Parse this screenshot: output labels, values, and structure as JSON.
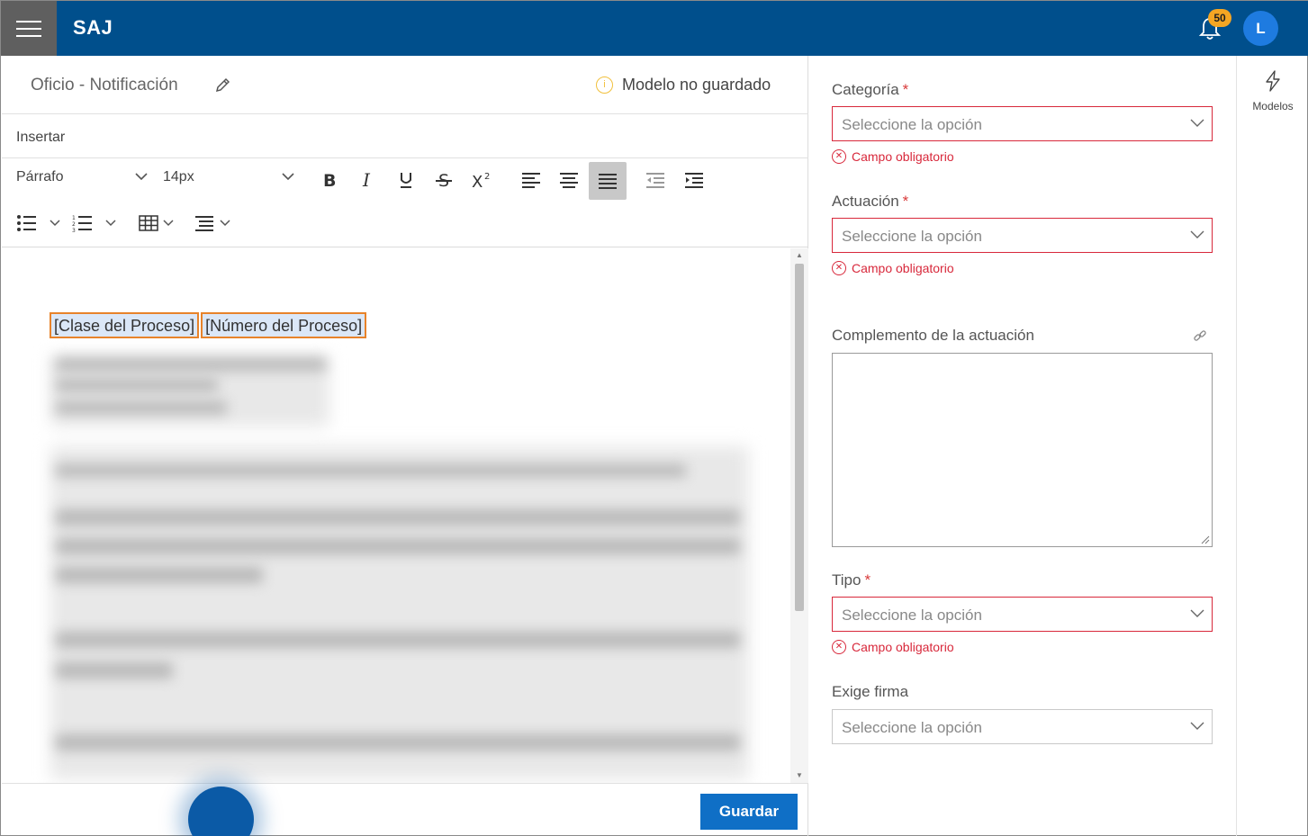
{
  "app": {
    "title": "SAJ",
    "notifications_count": "50",
    "avatar_initial": "L"
  },
  "document": {
    "title": "Oficio - Notificación",
    "status": "Modelo no guardado"
  },
  "editor": {
    "insert_label": "Insertar",
    "paragraph_style": "Párrafo",
    "font_size": "14px",
    "tags": [
      "[Clase del Proceso]",
      "[Número del Proceso]"
    ],
    "save_label": "Guardar"
  },
  "form": {
    "categoria": {
      "label": "Categoría",
      "placeholder": "Seleccione la opción",
      "error": "Campo obligatorio"
    },
    "actuacion": {
      "label": "Actuación",
      "placeholder": "Seleccione la opción",
      "error": "Campo obligatorio"
    },
    "complemento": {
      "label": "Complemento de la actuación"
    },
    "tipo": {
      "label": "Tipo",
      "placeholder": "Seleccione la opción",
      "error": "Campo obligatorio"
    },
    "exige_firma": {
      "label": "Exige firma",
      "placeholder": "Seleccione la opción"
    },
    "required_marker": "*"
  },
  "rail": {
    "modelos_label": "Modelos"
  },
  "icons": {
    "menu": "hamburger-menu-icon",
    "bell": "bell-icon",
    "edit": "pencil-icon",
    "status": "info-circle-icon",
    "link": "link-icon",
    "modelos": "lightning-bolt-icon"
  },
  "colors": {
    "topbar": "#004f8c",
    "accent": "#0f6fc6",
    "error": "#d8283b",
    "badge": "#f5a623",
    "tag_border": "#e8832a"
  }
}
